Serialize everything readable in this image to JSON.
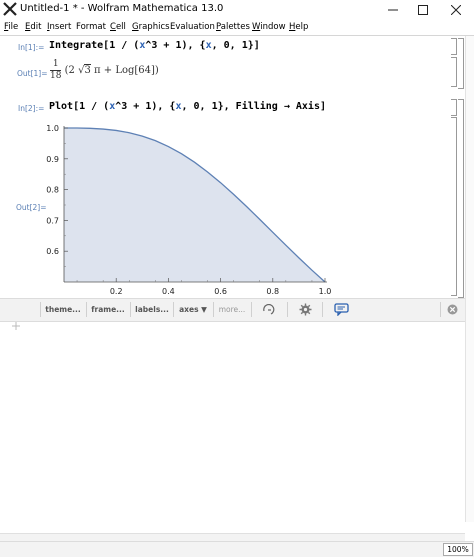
{
  "window": {
    "title": "Untitled-1 * - Wolfram Mathematica 13.0",
    "minimize_glyph": "—",
    "maximize_glyph": "☐",
    "close_glyph": "✕"
  },
  "menu": {
    "items": [
      {
        "first": "F",
        "rest": "ile"
      },
      {
        "first": "E",
        "rest": "dit"
      },
      {
        "first": "I",
        "rest": "nsert"
      },
      {
        "first": "F",
        "rest": "ormat",
        "underline_index": 1
      },
      {
        "first": "C",
        "rest": "ell"
      },
      {
        "first": "G",
        "rest": "raphics"
      },
      {
        "first": "E",
        "rest": "valuation",
        "underline_index": 1
      },
      {
        "first": "P",
        "rest": "alettes"
      },
      {
        "first": "W",
        "rest": "indow"
      },
      {
        "first": "H",
        "rest": "elp"
      }
    ]
  },
  "cells": {
    "in1_label": "In[1]:=",
    "in1_code": {
      "a": "Integrate[1 / (",
      "x1": "x",
      "b": "^3 + 1), {",
      "x2": "x",
      "c": ", 0, 1}]"
    },
    "out1_label": "Out[1]=",
    "out1": {
      "num": "1",
      "den": "18",
      "body_a": "(2 ",
      "sqrt": "√",
      "sqrt_arg": "3",
      "body_b": " π + Log[64])"
    },
    "in2_label": "In[2]:=",
    "in2_code": {
      "a": "Plot[1 / (",
      "x1": "x",
      "b": "^3 + 1), {",
      "x2": "x",
      "c": ", 0, 1}, Filling → Axis]"
    },
    "out2_label": "Out[2]="
  },
  "chart_data": {
    "type": "area",
    "function": "1/(x^3+1)",
    "x": [
      0,
      0.05,
      0.1,
      0.15,
      0.2,
      0.25,
      0.3,
      0.35,
      0.4,
      0.45,
      0.5,
      0.55,
      0.6,
      0.65,
      0.7,
      0.75,
      0.8,
      0.85,
      0.9,
      0.95,
      1.0
    ],
    "y": [
      1.0,
      0.9999,
      0.999,
      0.9966,
      0.9921,
      0.9846,
      0.9737,
      0.9589,
      0.9398,
      0.9165,
      0.8889,
      0.8573,
      0.8224,
      0.7846,
      0.7446,
      0.7033,
      0.6614,
      0.6195,
      0.5784,
      0.5383,
      0.5
    ],
    "xlim": [
      0,
      1
    ],
    "ylim": [
      0.5,
      1.0
    ],
    "xticks": [
      "0.2",
      "0.4",
      "0.6",
      "0.8",
      "1.0"
    ],
    "yticks": [
      "0.6",
      "0.7",
      "0.8",
      "0.9",
      "1.0"
    ],
    "filling": "axis",
    "line_color": "#5e81b5",
    "fill_color": "#dde3ee",
    "title": "",
    "xlabel": "",
    "ylabel": ""
  },
  "toolbar": {
    "theme_label": "theme...",
    "frame_label": "frame...",
    "labels_label": "labels...",
    "axes_label": "axes ▼",
    "more_label": "more...",
    "close_glyph": "✕"
  },
  "status": {
    "zoom": "100%"
  }
}
